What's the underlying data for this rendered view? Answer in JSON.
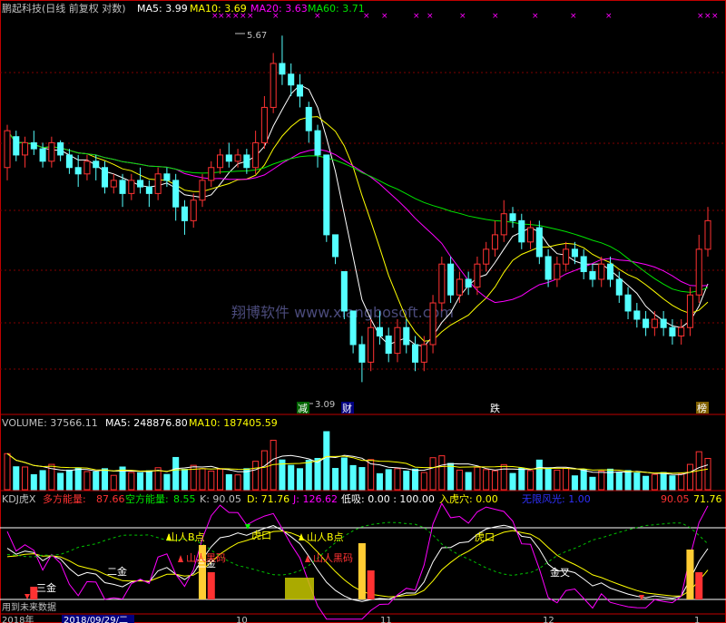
{
  "header": {
    "title": "鹏起科技(日线 前复权 对数)",
    "ma5": "MA5: 3.99",
    "ma10": "MA10: 3.69",
    "ma20": "MA20: 3.63",
    "ma60": "MA60: 3.71"
  },
  "price_panel": {
    "high_label": "5.67",
    "low_label": "3.09",
    "tags": [
      "减",
      "财",
      "跌",
      "榜"
    ],
    "watermark": "翔博软件 www.xiangbosoft.com"
  },
  "volume_panel": {
    "volume": "VOLUME: 37566.11",
    "ma5": "MA5: 248876.80",
    "ma10": "MA10: 187405.59"
  },
  "kdj_panel": {
    "name": "KDJ虎X",
    "bull_label": "多方能量:",
    "bull_value": "87.66",
    "bear_label": "空方能量:",
    "bear_value": "8.55",
    "k": "K: 90.05",
    "d": "D: 71.76",
    "j": "J: 126.62",
    "low_buy": "低吸: 0.00 : 100.00",
    "tiger_hole": "入虎穴: 0.00",
    "scenery": "无限风光: 1.00",
    "right_k": "90.05",
    "right_d": "71.76",
    "annotations": [
      "三金",
      "二金",
      "三金",
      "山人B点",
      "山人黑码",
      "虎口",
      "山人B点",
      "山人黑码",
      "虎口",
      "金叉"
    ]
  },
  "footer": {
    "left": "用到未来数据",
    "date": "2018/09/29/二",
    "year": "2018年",
    "ticks": [
      "10",
      "11",
      "12",
      "1"
    ]
  },
  "colors": {
    "up": "#ff3232",
    "down": "#54ffff",
    "ma5": "#ffffff",
    "ma10": "#ffff00",
    "ma20": "#ff00ff",
    "ma60": "#00e600",
    "text": "#c0c0c0"
  },
  "chart_data": {
    "type": "candlestick",
    "series": [
      {
        "name": "MA5",
        "values": [
          3.99
        ]
      },
      {
        "name": "MA10",
        "values": [
          3.69
        ]
      },
      {
        "name": "MA20",
        "values": [
          3.63
        ]
      },
      {
        "name": "MA60",
        "values": [
          3.71
        ]
      }
    ],
    "high": 5.67,
    "low": 3.09,
    "volume": 37566.11,
    "volume_ma5": 248876.8,
    "volume_ma10": 187405.59,
    "kdj": {
      "K": 90.05,
      "D": 71.76,
      "J": 126.62
    },
    "candles": [
      [
        4.5,
        4.8,
        4.4,
        4.85
      ],
      [
        4.75,
        4.6,
        4.55,
        4.8
      ],
      [
        4.6,
        4.7,
        4.5,
        4.75
      ],
      [
        4.7,
        4.65,
        4.6,
        4.8
      ],
      [
        4.65,
        4.55,
        4.5,
        4.7
      ],
      [
        4.55,
        4.7,
        4.5,
        4.75
      ],
      [
        4.7,
        4.6,
        4.55,
        4.72
      ],
      [
        4.6,
        4.5,
        4.45,
        4.65
      ],
      [
        4.5,
        4.45,
        4.35,
        4.6
      ],
      [
        4.45,
        4.55,
        4.4,
        4.6
      ],
      [
        4.55,
        4.5,
        4.4,
        4.6
      ],
      [
        4.5,
        4.35,
        4.3,
        4.55
      ],
      [
        4.35,
        4.4,
        4.3,
        4.45
      ],
      [
        4.4,
        4.3,
        4.2,
        4.45
      ],
      [
        4.3,
        4.4,
        4.25,
        4.45
      ],
      [
        4.4,
        4.35,
        4.3,
        4.5
      ],
      [
        4.35,
        4.3,
        4.2,
        4.4
      ],
      [
        4.3,
        4.45,
        4.25,
        4.5
      ],
      [
        4.45,
        4.4,
        4.35,
        4.5
      ],
      [
        4.4,
        4.2,
        4.1,
        4.45
      ],
      [
        4.2,
        4.1,
        4.0,
        4.25
      ],
      [
        4.1,
        4.25,
        4.05,
        4.3
      ],
      [
        4.25,
        4.4,
        4.2,
        4.45
      ],
      [
        4.4,
        4.5,
        4.35,
        4.55
      ],
      [
        4.5,
        4.6,
        4.45,
        4.65
      ],
      [
        4.6,
        4.55,
        4.5,
        4.7
      ],
      [
        4.55,
        4.6,
        4.5,
        4.65
      ],
      [
        4.6,
        4.5,
        4.45,
        4.65
      ],
      [
        4.5,
        4.7,
        4.45,
        4.8
      ],
      [
        4.7,
        5.0,
        4.65,
        5.1
      ],
      [
        5.0,
        5.4,
        4.95,
        5.5
      ],
      [
        5.4,
        5.3,
        5.2,
        5.67
      ],
      [
        5.3,
        5.2,
        5.1,
        5.4
      ],
      [
        5.2,
        5.1,
        5.0,
        5.3
      ],
      [
        5.0,
        4.8,
        4.7,
        5.05
      ],
      [
        4.8,
        4.6,
        4.5,
        4.85
      ],
      [
        4.6,
        4.0,
        3.95,
        4.6
      ],
      [
        4.0,
        3.85,
        3.8,
        4.0
      ],
      [
        3.75,
        3.5,
        3.45,
        3.75
      ],
      [
        3.5,
        3.3,
        3.25,
        3.5
      ],
      [
        3.3,
        3.2,
        3.09,
        3.35
      ],
      [
        3.2,
        3.4,
        3.15,
        3.45
      ],
      [
        3.4,
        3.35,
        3.3,
        3.5
      ],
      [
        3.35,
        3.25,
        3.2,
        3.4
      ],
      [
        3.25,
        3.4,
        3.2,
        3.45
      ],
      [
        3.4,
        3.3,
        3.25,
        3.45
      ],
      [
        3.3,
        3.2,
        3.15,
        3.35
      ],
      [
        3.2,
        3.3,
        3.15,
        3.35
      ],
      [
        3.3,
        3.55,
        3.25,
        3.6
      ],
      [
        3.55,
        3.8,
        3.5,
        3.85
      ],
      [
        3.8,
        3.6,
        3.55,
        3.85
      ],
      [
        3.6,
        3.7,
        3.55,
        3.75
      ],
      [
        3.7,
        3.65,
        3.6,
        3.75
      ],
      [
        3.65,
        3.8,
        3.6,
        3.85
      ],
      [
        3.8,
        3.9,
        3.75,
        3.95
      ],
      [
        3.9,
        4.0,
        3.85,
        4.1
      ],
      [
        4.0,
        4.15,
        3.95,
        4.25
      ],
      [
        4.15,
        4.1,
        4.05,
        4.2
      ],
      [
        4.1,
        3.95,
        3.9,
        4.15
      ],
      [
        3.95,
        4.05,
        3.9,
        4.1
      ],
      [
        4.05,
        3.85,
        3.8,
        4.1
      ],
      [
        3.85,
        3.7,
        3.65,
        3.9
      ],
      [
        3.7,
        3.8,
        3.65,
        3.85
      ],
      [
        3.8,
        3.9,
        3.75,
        3.95
      ],
      [
        3.9,
        3.85,
        3.8,
        3.95
      ],
      [
        3.85,
        3.75,
        3.7,
        3.9
      ],
      [
        3.75,
        3.7,
        3.65,
        3.8
      ],
      [
        3.7,
        3.8,
        3.65,
        3.85
      ],
      [
        3.8,
        3.7,
        3.65,
        3.85
      ],
      [
        3.7,
        3.6,
        3.55,
        3.75
      ],
      [
        3.6,
        3.5,
        3.45,
        3.65
      ],
      [
        3.5,
        3.45,
        3.4,
        3.55
      ],
      [
        3.45,
        3.4,
        3.35,
        3.5
      ],
      [
        3.4,
        3.45,
        3.35,
        3.5
      ],
      [
        3.45,
        3.4,
        3.35,
        3.5
      ],
      [
        3.4,
        3.35,
        3.3,
        3.45
      ],
      [
        3.35,
        3.4,
        3.3,
        3.45
      ],
      [
        3.4,
        3.6,
        3.35,
        3.65
      ],
      [
        3.6,
        3.9,
        3.55,
        4.0
      ],
      [
        3.9,
        4.1,
        3.85,
        4.2
      ]
    ]
  }
}
